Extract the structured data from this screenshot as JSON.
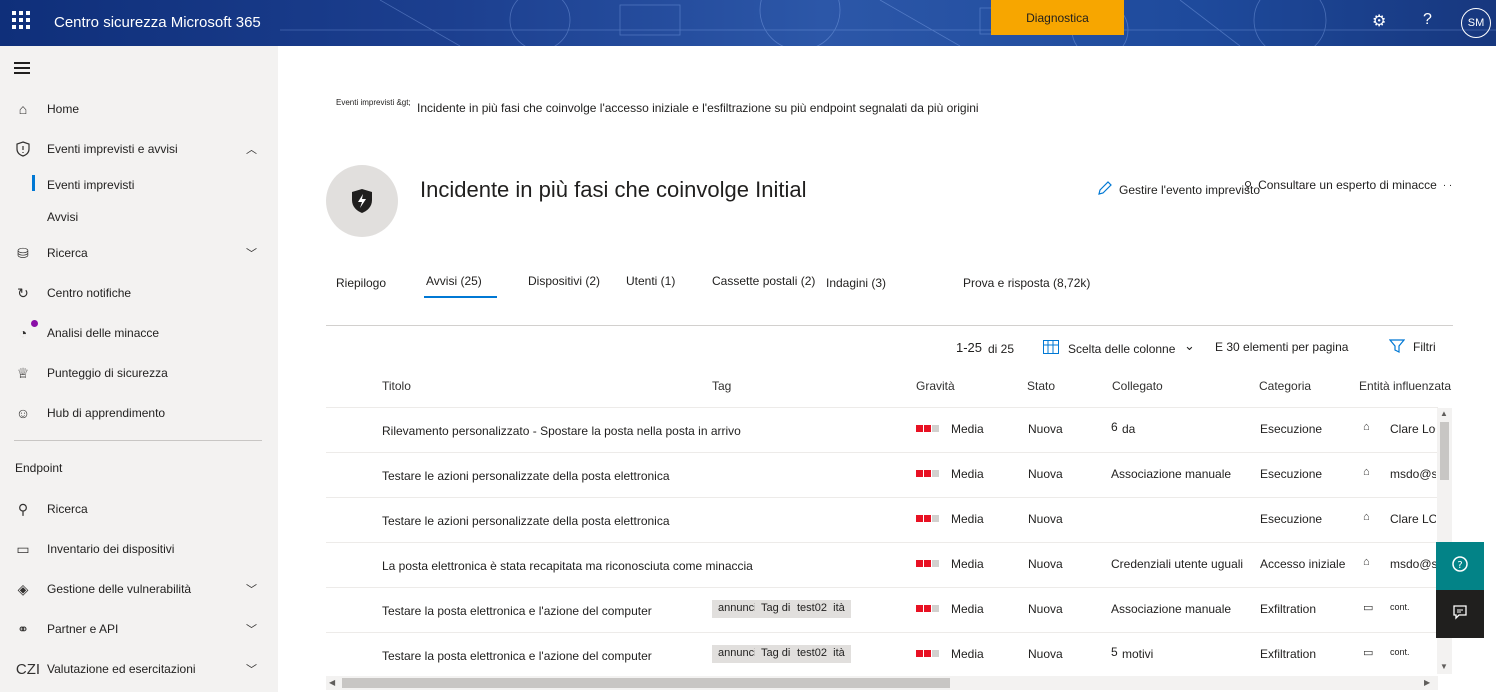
{
  "header": {
    "app_title": "Centro sicurezza Microsoft 365",
    "diagnostics_label": "Diagnostica",
    "user_initials": "SM"
  },
  "sidebar": {
    "items": [
      {
        "label": "Home",
        "icon": "home-icon"
      },
      {
        "label": "Eventi imprevisti e avvisi",
        "icon": "shield-icon"
      },
      {
        "label": "Eventi imprevisti"
      },
      {
        "label": "Avvisi"
      },
      {
        "label": "Ricerca",
        "icon": "hunting-icon"
      },
      {
        "label": "Centro notifiche",
        "icon": "action-center-icon"
      },
      {
        "label": "Analisi delle minacce",
        "icon": "threat-analytics-icon"
      },
      {
        "label": "Punteggio di sicurezza",
        "icon": "trophy-icon"
      },
      {
        "label": "Hub di apprendimento",
        "icon": "learning-hub-icon"
      }
    ],
    "section_endpoint": "Endpoint",
    "endpoint_items": [
      {
        "label": "Ricerca",
        "icon": "search-icon"
      },
      {
        "label": "Inventario dei dispositivi",
        "icon": "laptop-icon"
      },
      {
        "label": "Gestione delle vulnerabilità",
        "icon": "vulnerability-icon"
      },
      {
        "label": "Partner e API",
        "icon": "partners-icon"
      },
      {
        "label": "Valutazione ed esercitazioni",
        "icon_text": "CZI"
      }
    ]
  },
  "breadcrumb": {
    "parent": "Eventi imprevisti &gt;",
    "current": "Incidente in più fasi che coinvolge l'accesso iniziale e l'esfiltrazione su più endpoint segnalati da più origini"
  },
  "incident": {
    "title": "Incidente in più fasi che coinvolge Initial",
    "manage_label": "Gestire l'evento imprevisto",
    "consult_label": "Consultare un esperto di minacce"
  },
  "tabs": [
    "Riepilogo",
    "Avvisi (25)",
    "Dispositivi (2)",
    "Utenti (1)",
    "Cassette postali (2)",
    "Indagini (3)",
    "Prova e risposta (8,72k)"
  ],
  "toolbar": {
    "range": "1-25",
    "of": "di 25",
    "columns_label": "Scelta delle colonne",
    "per_page_label": "E 30 elementi per pagina",
    "filters_label": "Filtri"
  },
  "table": {
    "headers": [
      "Titolo",
      "Tag",
      "Gravità",
      "Stato",
      "Collegato",
      "Categoria",
      "Entità influenzata"
    ],
    "rows": [
      {
        "title": "Rilevamento personalizzato - Spostare la posta nella posta in arrivo",
        "tags": [],
        "severity": "Media",
        "status": "Nuova",
        "linked_num": "6",
        "linked": "da",
        "category": "Esecuzione",
        "entity": "Clare Lo•",
        "entity_icon": "mailbox-icon"
      },
      {
        "title": "Testare le azioni personalizzate della posta elettronica",
        "tags": [],
        "severity": "Media",
        "status": "Nuova",
        "linked_num": "",
        "linked": "Associazione manuale",
        "category": "Esecuzione",
        "entity": "msdo@s",
        "entity_icon": "mailbox-icon"
      },
      {
        "title": "Testare le azioni personalizzate della posta elettronica",
        "tags": [],
        "severity": "Media",
        "status": "Nuova",
        "linked_num": "",
        "linked": "",
        "category": "Esecuzione",
        "entity": "Clare LO'",
        "entity_icon": "mailbox-icon"
      },
      {
        "title": "La posta elettronica è stata recapitata ma riconosciuta come minaccia",
        "tags": [],
        "severity": "Media",
        "status": "Nuova",
        "linked_num": "",
        "linked": "Credenziali utente uguali",
        "category": "Accesso iniziale",
        "entity": "msdo@s",
        "entity_icon": "mailbox-icon"
      },
      {
        "title": "Testare la posta elettronica e l'azione del computer",
        "tags": [
          "annunci",
          "Tag di conformità",
          "test02"
        ],
        "severity": "Media",
        "status": "Nuova",
        "linked_num": "",
        "linked": "Associazione manuale",
        "category": "Exfiltration",
        "entity": "cont.",
        "entity_icon": "laptop-icon"
      },
      {
        "title": "Testare la posta elettronica e l'azione del computer",
        "tags": [
          "annunci",
          "Tag di conformità",
          "test02"
        ],
        "severity": "Media",
        "status": "Nuova",
        "linked_num": "5",
        "linked": "motivi",
        "category": "Exfiltration",
        "entity": "cont.",
        "entity_icon": "laptop-icon"
      }
    ]
  },
  "colors": {
    "accent": "#0078d4",
    "diagnostics": "#f7a600",
    "severity_high": "#e81123",
    "help_button": "#038387",
    "feedback_button": "#201f1e"
  }
}
